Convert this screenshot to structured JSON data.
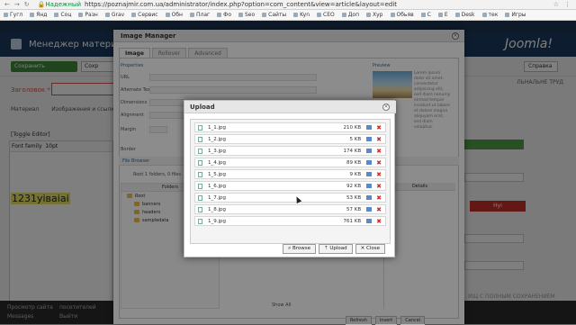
{
  "browser": {
    "secure_label": "Надежный",
    "url": "https://poznajmir.com.ua/administrator/index.php?option=com_content&view=article&layout=edit",
    "bookmarks": [
      "Гугл",
      "Янд",
      "Соц",
      "Разн",
      "Grav",
      "Сервис",
      "Обн",
      "Плаг",
      "Фо",
      "Seo",
      "Сайты",
      "Kyn",
      "СЕО",
      "Доп",
      "Хур",
      "Обьяв",
      "С",
      "Е",
      "Desk",
      "тек",
      "Игры"
    ]
  },
  "joomla": {
    "header_title": "Менеджер материал",
    "logo": "Joomla!",
    "save_label": "Сохранить",
    "save2_label": "Сохр",
    "help_label": "Справка",
    "title_label": "Заголовок *",
    "tabs": [
      "Материал",
      "Изображения и ссылк"
    ],
    "toggle_editor": "[Toggle Editor]",
    "editor_font": "Font family",
    "editor_size": "10pt",
    "editor_text": "1231yiвaiai",
    "right_label": "ЛЬНАЛЬНЕ ТРУД",
    "red_button": "Нуі",
    "footer_left1": "Просмотр сайта",
    "footer_left2": "Messages",
    "footer_left3": "посетителей",
    "footer_left4": "Выйти",
    "footer_right": "ИЩ С ПОЛНЫМ СОХРАНЕНИЕМ"
  },
  "image_manager": {
    "title": "Image Manager",
    "tabs": [
      "Image",
      "Rollover",
      "Advanced"
    ],
    "properties_label": "Properties",
    "preview_label": "Preview",
    "fields": [
      "URL",
      "Alternate Text",
      "Dimensions",
      "Alignment",
      "Margin",
      "Border"
    ],
    "lorem": "Lorem ipsum dolor sit amet, consectetur adipiscing elit, sed diam nonumy eirmod tempor invidunt ut labore et dolore magna aliquyam erat, sed diam voluptua.",
    "file_browser_label": "File Browser",
    "root_path": "Root  1 folders, 0 files",
    "folders_header": "Folders",
    "folders": [
      "Root",
      "banners",
      "headers",
      "sampledata"
    ],
    "details_header": "Details",
    "show_label": "Show",
    "show_value": "All",
    "footer_buttons": [
      "Refresh",
      "Insert",
      "Cancel"
    ]
  },
  "upload": {
    "title": "Upload",
    "files": [
      {
        "name": "1_1.jpg",
        "size": "210 KB"
      },
      {
        "name": "1_2.jpg",
        "size": "5 KB"
      },
      {
        "name": "1_3.jpg",
        "size": "174 KB"
      },
      {
        "name": "1_4.jpg",
        "size": "89 KB"
      },
      {
        "name": "1_5.jpg",
        "size": "9 KB"
      },
      {
        "name": "1_6.jpg",
        "size": "92 KB"
      },
      {
        "name": "1_7.jpg",
        "size": "53 KB"
      },
      {
        "name": "1_8.jpg",
        "size": "57 KB"
      },
      {
        "name": "1_9.jpg",
        "size": "761 KB"
      }
    ],
    "browse_label": "Browse",
    "upload_label": "Upload",
    "close_label": "Close"
  }
}
